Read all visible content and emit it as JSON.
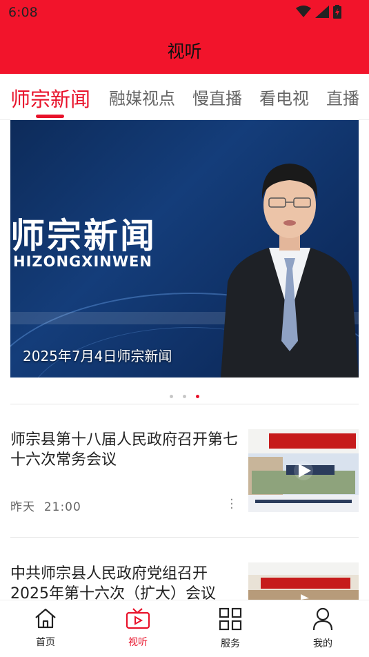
{
  "status_bar": {
    "time": "6:08"
  },
  "header": {
    "title": "视听",
    "bg_color": "#f2142b"
  },
  "tabs": [
    {
      "label": "师宗新闻",
      "active": true
    },
    {
      "label": "融媒视点"
    },
    {
      "label": "慢直播"
    },
    {
      "label": "看电视"
    },
    {
      "label": "直播"
    }
  ],
  "banner": {
    "logo_cn": "师宗新闻",
    "logo_en": "HIZONGXINWEN",
    "caption": "2025年7月4日师宗新闻",
    "slide_count": 3,
    "active_slide": 3
  },
  "news": [
    {
      "title": "师宗县第十八届人民政府召开第七十六次常务会议",
      "date": "昨天",
      "time": "21:00",
      "thumb_icon": "play-icon"
    },
    {
      "title": "中共师宗县人民政府党组召开2025年第十六次（扩大）会议",
      "thumb_icon": "play-icon"
    }
  ],
  "bottom_nav": [
    {
      "label": "首页",
      "icon": "home-icon"
    },
    {
      "label": "视听",
      "icon": "video-icon",
      "active": true
    },
    {
      "label": "服务",
      "icon": "grid-icon"
    },
    {
      "label": "我的",
      "icon": "user-icon"
    }
  ],
  "accent_color": "#e8122a"
}
